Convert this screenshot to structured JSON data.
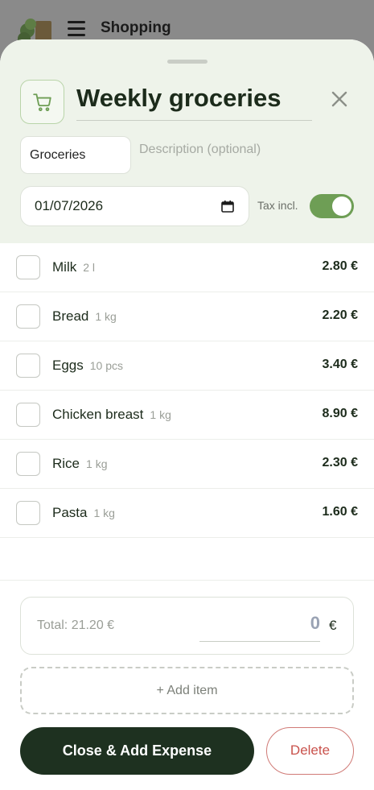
{
  "background": {
    "header_title": "Shopping"
  },
  "sheet": {
    "list_title": "Weekly groceries",
    "category_value": "Groceries",
    "description_placeholder": "Description (optional)",
    "date_value": "01/07/2026",
    "tax_label": "Tax incl.",
    "tax_included": true
  },
  "items": [
    {
      "name": "Milk",
      "qty": "2 l",
      "price": "2.80 €"
    },
    {
      "name": "Bread",
      "qty": "1 kg",
      "price": "2.20 €"
    },
    {
      "name": "Eggs",
      "qty": "10 pcs",
      "price": "3.40 €"
    },
    {
      "name": "Chicken breast",
      "qty": "1 kg",
      "price": "8.90 €"
    },
    {
      "name": "Rice",
      "qty": "1 kg",
      "price": "2.30 €"
    },
    {
      "name": "Pasta",
      "qty": "1 kg",
      "price": "1.60 €"
    }
  ],
  "footer": {
    "total_label": "Total: 21.20 €",
    "amount_value": "0",
    "currency": "€",
    "add_item_label": "+ Add item",
    "close_add_label": "Close & Add Expense",
    "delete_label": "Delete"
  },
  "colors": {
    "accent_green": "#6e9e55",
    "dark_button": "#1e3120",
    "delete_red": "#c9524c"
  }
}
